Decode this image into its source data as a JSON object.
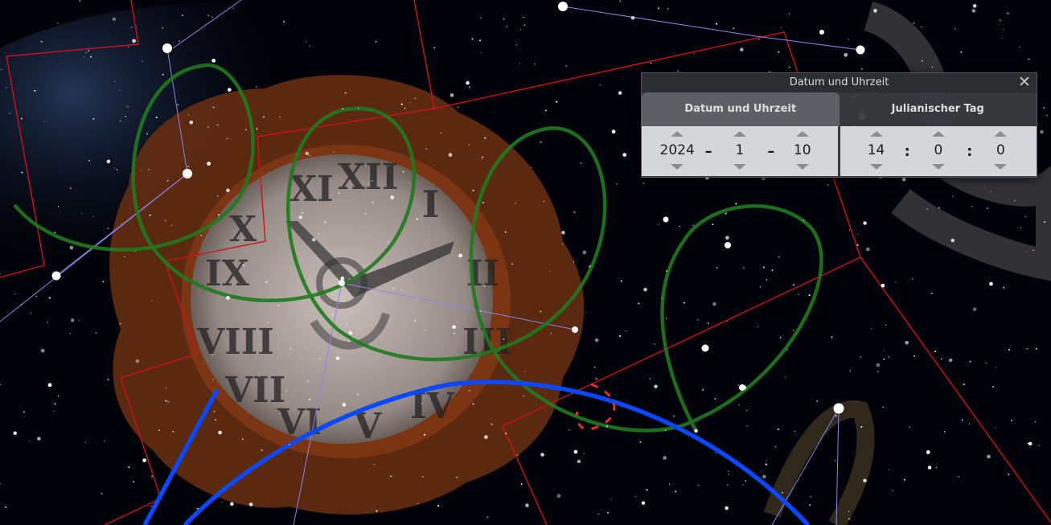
{
  "dialog": {
    "title": "Datum und Uhrzeit",
    "tabs": [
      {
        "label": "Datum und Uhrzeit",
        "active": true
      },
      {
        "label": "Julianischer Tag",
        "active": false
      }
    ],
    "date": {
      "year": "2024",
      "month": "1",
      "day": "10",
      "separator": "–"
    },
    "time": {
      "hour": "14",
      "minute": "0",
      "second": "0",
      "separator": ":"
    }
  },
  "colors": {
    "constellation_boundary": "#d0101a",
    "ecliptic_loop": "#1f7a1f",
    "horizon_circle": "#0a48ff",
    "constellation_line": "#8a87e8",
    "dialog_bg": "#3c3e42"
  },
  "icons": {
    "close": "close-icon"
  }
}
